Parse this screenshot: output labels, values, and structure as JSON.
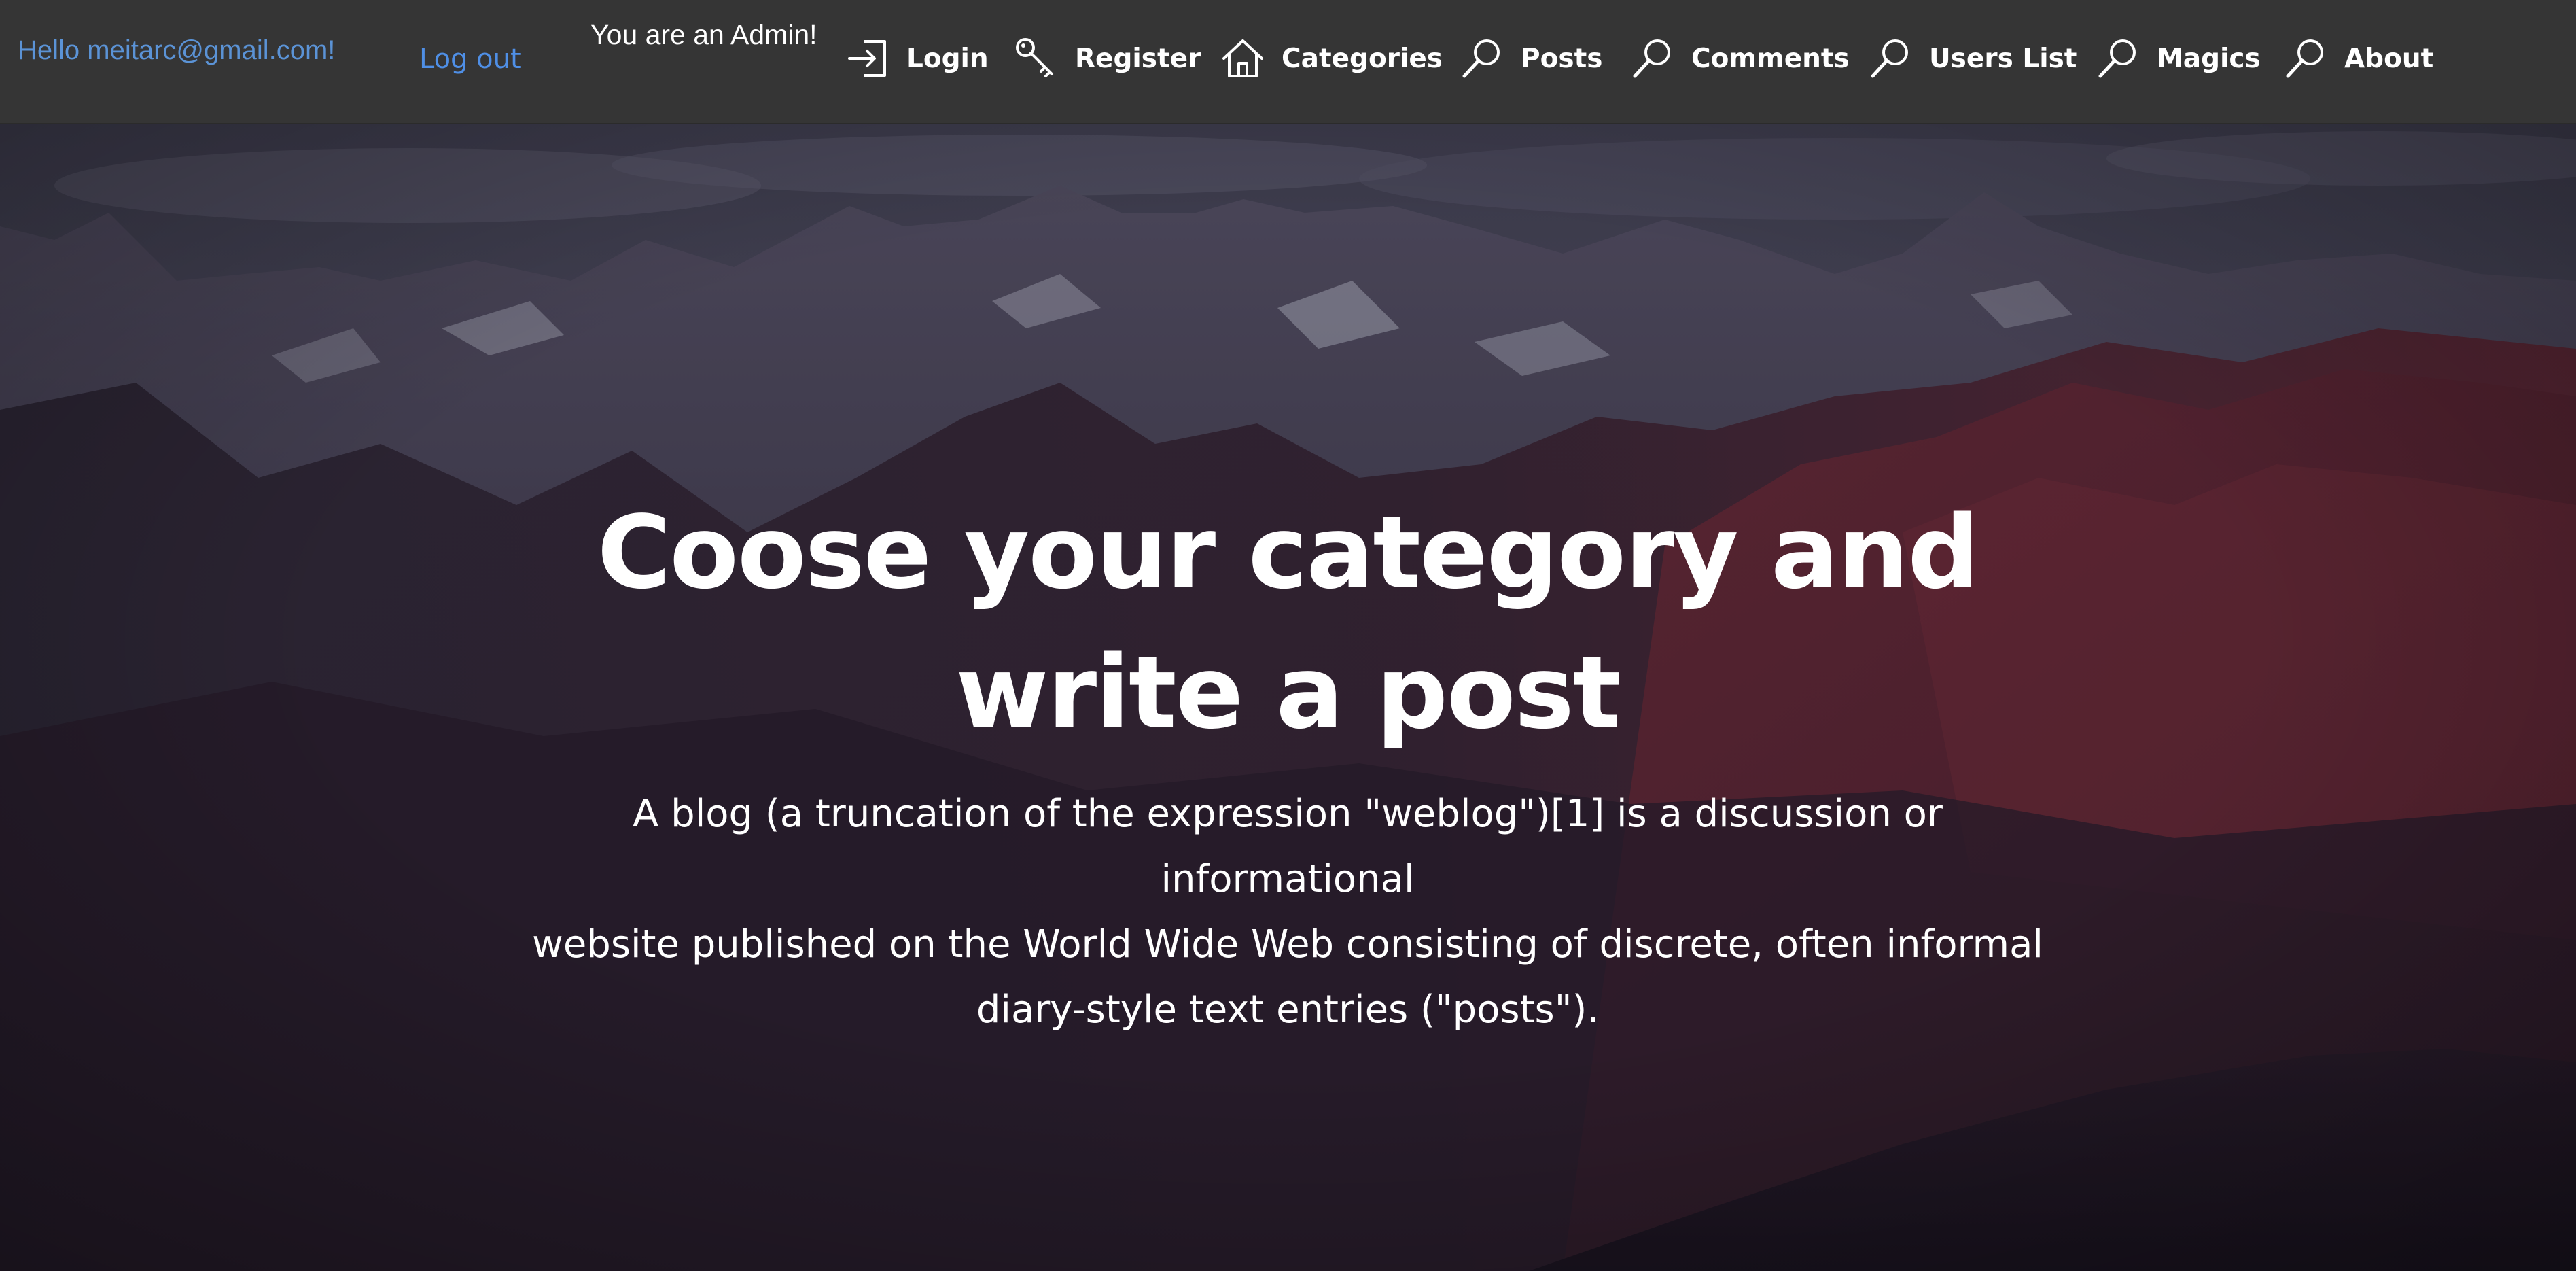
{
  "header": {
    "greeting": "Hello meitarc@gmail.com!",
    "logout_label": "Log out",
    "admin_note": "You are an Admin!"
  },
  "nav": {
    "items": [
      {
        "label": "Login",
        "icon": "login-icon"
      },
      {
        "label": "Register",
        "icon": "key-icon"
      },
      {
        "label": "Categories",
        "icon": "home-icon"
      },
      {
        "label": "Posts",
        "icon": "search-icon"
      },
      {
        "label": "Comments",
        "icon": "search-icon"
      },
      {
        "label": "Users List",
        "icon": "search-icon"
      },
      {
        "label": "Magics",
        "icon": "search-icon"
      },
      {
        "label": "About",
        "icon": "search-icon"
      }
    ]
  },
  "hero": {
    "title_line1": "Coose your category and",
    "title_line2": "write a post",
    "description_line1": "A blog (a truncation of the expression \"weblog\")[1] is a discussion or informational",
    "description_line2": "website published on the World Wide Web consisting of discrete, often informal",
    "description_line3": "diary-style text entries (\"posts\").",
    "background": "mountain-landscape-image"
  },
  "colors": {
    "navbar_bg": "#353535",
    "greeting_text": "#5b93d6",
    "logout_link": "#4f8fe6",
    "nav_text": "#ffffff",
    "hero_text": "#ffffff"
  }
}
